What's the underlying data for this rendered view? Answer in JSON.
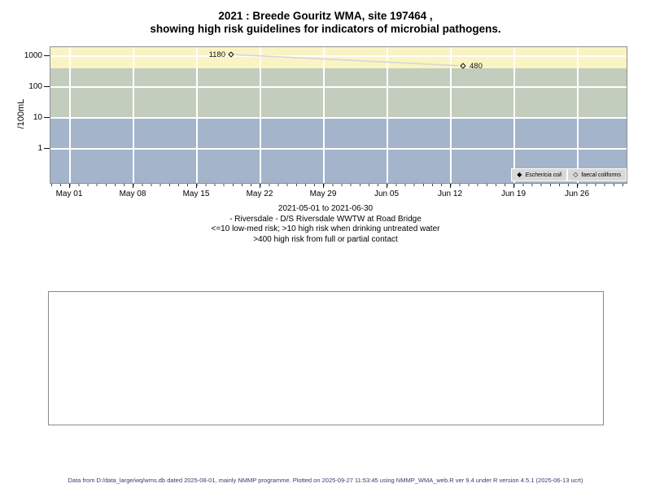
{
  "title": {
    "line1": "2021 : Breede Gouritz WMA, site 197464 ,",
    "line2": "showing high risk guidelines for indicators of microbial pathogens."
  },
  "chart_data": {
    "type": "scatter",
    "title": "2021 : Breede Gouritz WMA, site 197464 , showing high risk guidelines for indicators of microbial pathogens.",
    "ylabel": "/100mL",
    "y_scale": "log",
    "y_ticks": [
      "1000",
      "100",
      "10",
      "1"
    ],
    "x_ticks": [
      "May 01",
      "May 08",
      "May 15",
      "May 22",
      "May 29",
      "Jun 05",
      "Jun 12",
      "Jun 19",
      "Jun 26"
    ],
    "x_range": [
      "2021-05-01",
      "2021-06-30"
    ],
    "grid": "on",
    "legend_position": "bottom-right-inside",
    "series": [
      {
        "name": "Eschericia coli",
        "symbol": "filled-diamond",
        "points": []
      },
      {
        "name": "faecal coliforms",
        "symbol": "open-diamond",
        "points": [
          {
            "date": "2021-05-19",
            "value": 1180
          },
          {
            "date": "2021-06-13",
            "value": 480
          }
        ]
      }
    ],
    "point_labels": {
      "p1": "1180",
      "p2": "480"
    },
    "risk_bands": [
      {
        "range": ">400",
        "color": "#FAF3C4",
        "meaning": "high risk from full or partial contact"
      },
      {
        "range": "10-400",
        "color": "#C3CDBD",
        "meaning": "high risk when drinking untreated water"
      },
      {
        "range": "<=10",
        "color": "#A3B4CB",
        "meaning": "low-med risk"
      }
    ]
  },
  "legend": {
    "entry1": "Eschericia coli",
    "entry2": "faecal coliforms"
  },
  "subtitle": {
    "line1": "2021-05-01 to 2021-06-30",
    "line2": "- Riversdale - D/S Riversdale WWTW at Road Bridge",
    "line3": "<=10 low-med risk; >10 high risk when drinking untreated water",
    "line4": ">400 high risk from full or partial contact"
  },
  "footer": {
    "text": "Data from D:/data_large/wq/wms.db dated 2025-08-01, mainly NMMP programme. Plotted on 2025-09-27 11:53:45 using NMMP_WMA_web.R ver 9.4 under R version 4.5.1 (2025-06-13 ucrt)"
  }
}
